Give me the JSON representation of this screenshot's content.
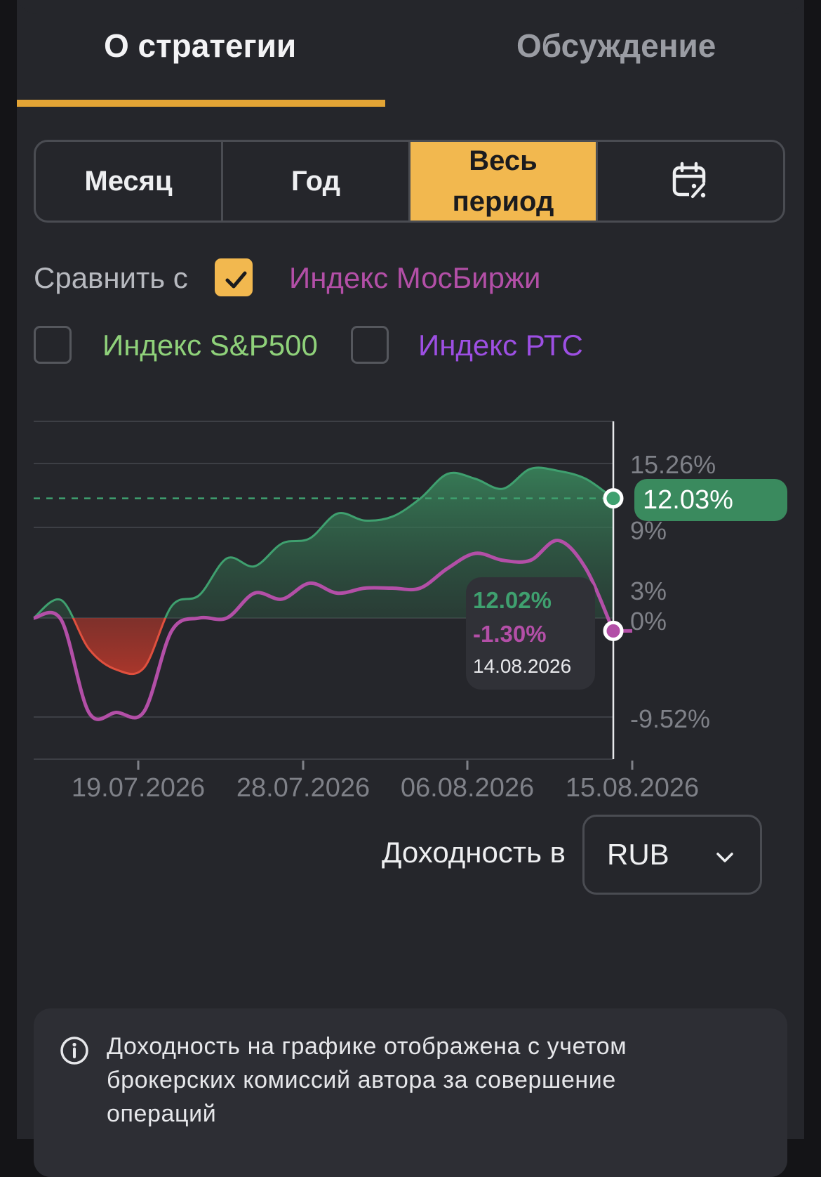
{
  "tabs": [
    {
      "label": "О стратегии",
      "active": true
    },
    {
      "label": "Обсуждение",
      "active": false
    }
  ],
  "period": {
    "options": [
      "Месяц",
      "Год",
      "Весь\nпериод"
    ],
    "selected": "Весь\nпериод",
    "calendar_icon": "calendar-percent-icon"
  },
  "compare": {
    "label": "Сравнить с",
    "indices": [
      {
        "label": "Индекс МосБиржи",
        "checked": true,
        "color": "#b34fa7"
      },
      {
        "label": "Индекс S&P500",
        "checked": false,
        "color": "#8fd17a"
      },
      {
        "label": "Индекс РТС",
        "checked": false,
        "color": "#9d4fe3"
      }
    ]
  },
  "colors": {
    "accent": "#f2b84f",
    "strategy": "#3fa06f",
    "loss": "#c0392b",
    "index": "#b34fa7"
  },
  "chart_data": {
    "type": "line",
    "y_ticks": [
      "15.26%",
      "9%",
      "3%",
      "0%",
      "-9.52%"
    ],
    "x_ticks": [
      "19.07.2026",
      "28.07.2026",
      "06.08.2026",
      "15.08.2026"
    ],
    "ylim": [
      -13.7,
      18.9
    ],
    "current_value_label": "12.03%",
    "series": [
      {
        "values": [
          0,
          1.8,
          -3.1,
          -5.2,
          -5.0,
          1.2,
          2.3,
          6.0,
          5.2,
          7.5,
          8.0,
          10.5,
          9.8,
          10.2,
          12.0,
          14.5,
          14.0,
          13.0,
          15.0,
          14.8,
          14.0,
          12.03
        ]
      },
      {
        "name": "Индекс МосБиржи",
        "values": [
          0,
          -0.2,
          -9.5,
          -9.5,
          -9.4,
          -1.3,
          0,
          0,
          2.5,
          1.9,
          3.5,
          2.5,
          3.0,
          3.0,
          3.0,
          5.0,
          6.5,
          5.8,
          5.8,
          7.8,
          5.0,
          -1.3
        ]
      }
    ],
    "tooltip": {
      "strategy_value": "12.02%",
      "index_value": "-1.30%",
      "date": "14.08.2026"
    }
  },
  "currency": {
    "label": "Доходность в",
    "selected": "RUB"
  },
  "info": {
    "text": "Доходность на графике отображена с учетом брокерских комиссий автора за совершение операций"
  }
}
